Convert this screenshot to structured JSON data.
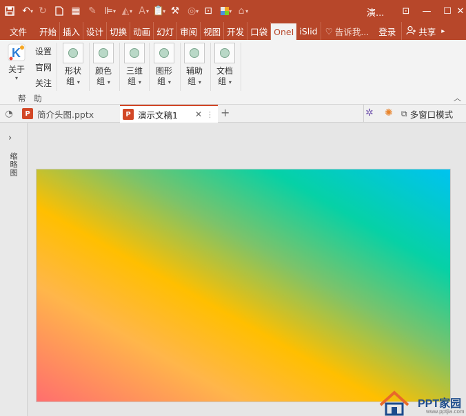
{
  "window": {
    "title": "演..."
  },
  "ribbon_tabs": [
    {
      "label": "文件"
    },
    {
      "label": "开始"
    },
    {
      "label": "插入"
    },
    {
      "label": "设计"
    },
    {
      "label": "切换"
    },
    {
      "label": "动画"
    },
    {
      "label": "幻灯"
    },
    {
      "label": "审阅"
    },
    {
      "label": "视图"
    },
    {
      "label": "开发"
    },
    {
      "label": "口袋"
    },
    {
      "label": "OneI"
    },
    {
      "label": "iSlid"
    }
  ],
  "tell_me": "告诉我...",
  "login": "登录",
  "share": "共享",
  "ribbon": {
    "about": "关于",
    "settings": "设置",
    "official_site": "官网",
    "follow": "关注",
    "help_group": "帮 助",
    "groups": [
      {
        "l1": "形状",
        "l2": "组"
      },
      {
        "l1": "颜色",
        "l2": "组"
      },
      {
        "l1": "三维",
        "l2": "组"
      },
      {
        "l1": "图形",
        "l2": "组"
      },
      {
        "l1": "辅助",
        "l2": "组"
      },
      {
        "l1": "文档",
        "l2": "组"
      }
    ]
  },
  "doc_tabs": [
    {
      "name": "简介头图.pptx"
    },
    {
      "name": "演示文稿1"
    }
  ],
  "multi_window": "多窗口模式",
  "side_panel_label": "缩略图",
  "slide": {
    "gradient_colors": [
      "#ff6e6e",
      "#ffb64a",
      "#ffbf00",
      "#7cc36a",
      "#06d1a6",
      "#00c3f0"
    ]
  },
  "watermark": {
    "text": "PPT家园",
    "url": "www.pptjia.com"
  },
  "colors": {
    "accent": "#b7472a",
    "ppt_orange": "#d24726"
  }
}
